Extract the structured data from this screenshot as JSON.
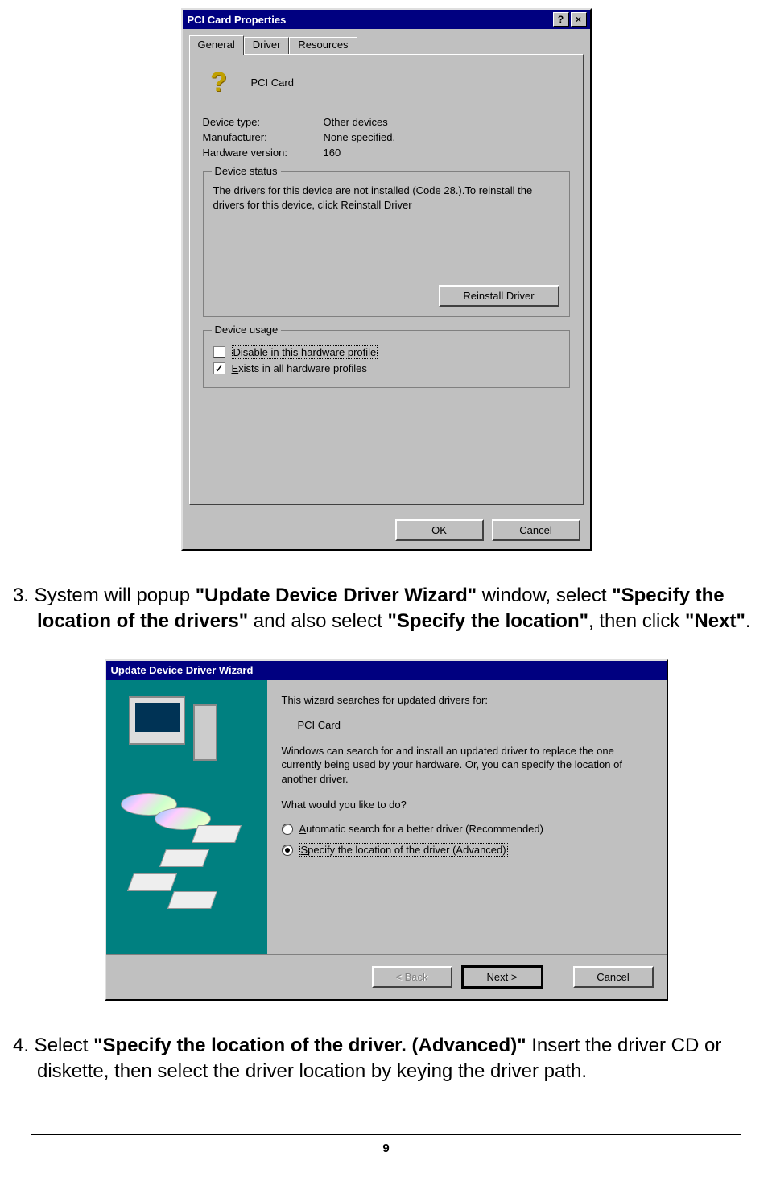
{
  "dialog1": {
    "title": "PCI Card Properties",
    "help_btn": "?",
    "close_btn": "×",
    "tabs": {
      "general": "General",
      "driver": "Driver",
      "resources": "Resources"
    },
    "device_name": "PCI Card",
    "fields": {
      "type_label": "Device type:",
      "type_value": "Other devices",
      "mfr_label": "Manufacturer:",
      "mfr_value": "None specified.",
      "hw_label": "Hardware version:",
      "hw_value": "160"
    },
    "status_group": "Device status",
    "status_text": "The drivers for this device are not installed  (Code 28.).To reinstall the drivers for this device, click Reinstall Driver",
    "reinstall_btn": "Reinstall Driver",
    "usage_group": "Device usage",
    "chk_disable": "Disable in this hardware profile",
    "chk_exists": "Exists in all hardware profiles",
    "ok_btn": "OK",
    "cancel_btn": "Cancel"
  },
  "step3": {
    "prefix": "3. System will popup ",
    "b1": "\"Update Device Driver Wizard\"",
    "mid1": " window, select ",
    "b2": "\"Specify the location of the drivers\"",
    "mid2": " and also select ",
    "b3": "\"Specify the location\"",
    "mid3": ",   then click ",
    "b4": "\"Next\"",
    "suffix": "."
  },
  "dialog2": {
    "title": "Update Device Driver Wizard",
    "intro": "This wizard searches for updated drivers for:",
    "device": "PCI Card",
    "desc": "Windows can search for and install an updated driver to replace the one currently being used by your hardware. Or, you can specify the location of another driver.",
    "question": "What would you like to do?",
    "opt_auto": "Automatic search for a better driver (Recommended)",
    "opt_specify": "Specify the location of the driver (Advanced)",
    "back_btn": "< Back",
    "next_btn": "Next >",
    "cancel_btn": "Cancel"
  },
  "step4": {
    "prefix": "4. Select ",
    "b1": "\"Specify the location of the driver. (Advanced)\"",
    "mid": " Insert the driver CD or diskette, then select the driver location by keying the driver path."
  },
  "page_number": "9"
}
